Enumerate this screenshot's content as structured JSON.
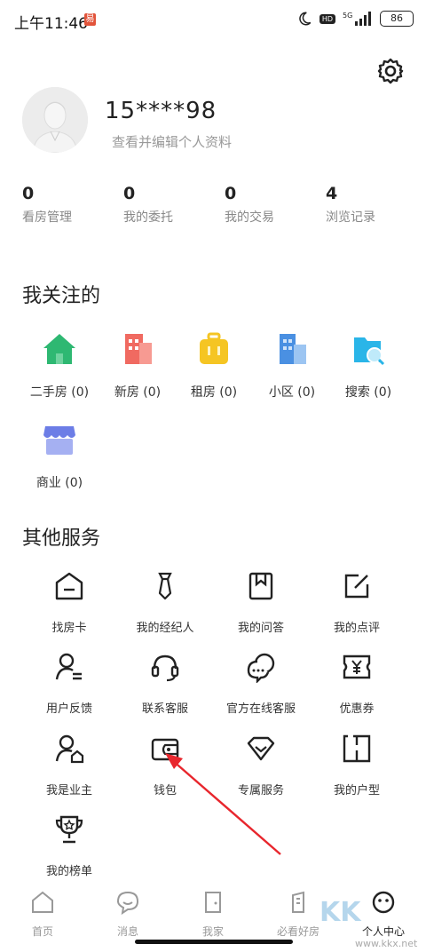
{
  "status_bar": {
    "time": "上午11:46",
    "notif": "易",
    "hd": "HD",
    "network": "5G",
    "battery": "86"
  },
  "profile": {
    "username": "15****98",
    "subtitle": "查看并编辑个人资料"
  },
  "stats": [
    {
      "value": "0",
      "label": "看房管理"
    },
    {
      "value": "0",
      "label": "我的委托"
    },
    {
      "value": "0",
      "label": "我的交易"
    },
    {
      "value": "4",
      "label": "浏览记录"
    }
  ],
  "follow": {
    "title": "我关注的",
    "items": [
      {
        "label": "二手房 (0)",
        "icon": "house-icon",
        "color": "#2eb872"
      },
      {
        "label": "新房 (0)",
        "icon": "building-icon",
        "color": "#f06a61"
      },
      {
        "label": "租房 (0)",
        "icon": "suitcase-icon",
        "color": "#f5c523"
      },
      {
        "label": "小区 (0)",
        "icon": "community-icon",
        "color": "#4a90e2"
      },
      {
        "label": "搜索 (0)",
        "icon": "search-icon",
        "color": "#2ab5e8"
      },
      {
        "label": "商业 (0)",
        "icon": "shop-icon",
        "color": "#6c7de6"
      }
    ]
  },
  "services": {
    "title": "其他服务",
    "items": [
      {
        "label": "找房卡",
        "icon": "house-card-icon"
      },
      {
        "label": "我的经纪人",
        "icon": "tie-icon"
      },
      {
        "label": "我的问答",
        "icon": "bookmark-icon"
      },
      {
        "label": "我的点评",
        "icon": "edit-icon"
      },
      {
        "label": "用户反馈",
        "icon": "user-feedback-icon"
      },
      {
        "label": "联系客服",
        "icon": "headset-icon"
      },
      {
        "label": "官方在线客服",
        "icon": "chat-icon"
      },
      {
        "label": "优惠券",
        "icon": "coupon-icon"
      },
      {
        "label": "我是业主",
        "icon": "owner-icon"
      },
      {
        "label": "钱包",
        "icon": "wallet-icon"
      },
      {
        "label": "专属服务",
        "icon": "diamond-icon"
      },
      {
        "label": "我的户型",
        "icon": "floorplan-icon"
      },
      {
        "label": "我的榜单",
        "icon": "trophy-icon"
      }
    ]
  },
  "nav": [
    {
      "label": "首页",
      "icon": "home-icon",
      "active": false
    },
    {
      "label": "消息",
      "icon": "message-icon",
      "active": false
    },
    {
      "label": "我家",
      "icon": "door-icon",
      "active": false
    },
    {
      "label": "必看好房",
      "icon": "tower-icon",
      "active": false
    },
    {
      "label": "个人中心",
      "icon": "profile-icon",
      "active": true
    }
  ],
  "watermark": {
    "text": "KK",
    "url": "www.kkx.net"
  }
}
